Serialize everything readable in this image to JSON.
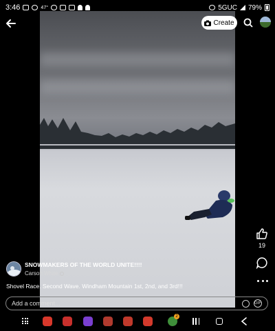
{
  "status_bar": {
    "time": "3:46",
    "temperature": "47°",
    "network": "5GUC",
    "battery": "79%"
  },
  "top_bar": {
    "create_label": "Create"
  },
  "post": {
    "group_name": "SNOWMAKERS OF THE WORLD UNITE!!!!",
    "author": "Carson White",
    "caption": "Shovel Race. Second Wave. Windham Mountain 1st, 2nd, and 3rd!!!",
    "like_count": "19"
  },
  "comment_bar": {
    "placeholder": "Add a comment...",
    "gif_label": "GIF"
  },
  "nav_bar": {
    "notification_badge": "2",
    "apps": [
      {
        "name": "phone-app-icon",
        "color": "#d8382b"
      },
      {
        "name": "messages-app-icon",
        "color": "#c8302c"
      },
      {
        "name": "browser-app-icon",
        "color": "#7a3fd0"
      },
      {
        "name": "camera-app-icon",
        "color": "#b03a2e"
      },
      {
        "name": "gallery-app-icon",
        "color": "#c0392b"
      },
      {
        "name": "video-app-icon",
        "color": "#d33a2c"
      },
      {
        "name": "game-app-icon",
        "color": "#3f8f3a"
      }
    ]
  },
  "colors": {
    "background": "#000000",
    "create_button": "#ffffff",
    "badge": "#f0a020"
  }
}
